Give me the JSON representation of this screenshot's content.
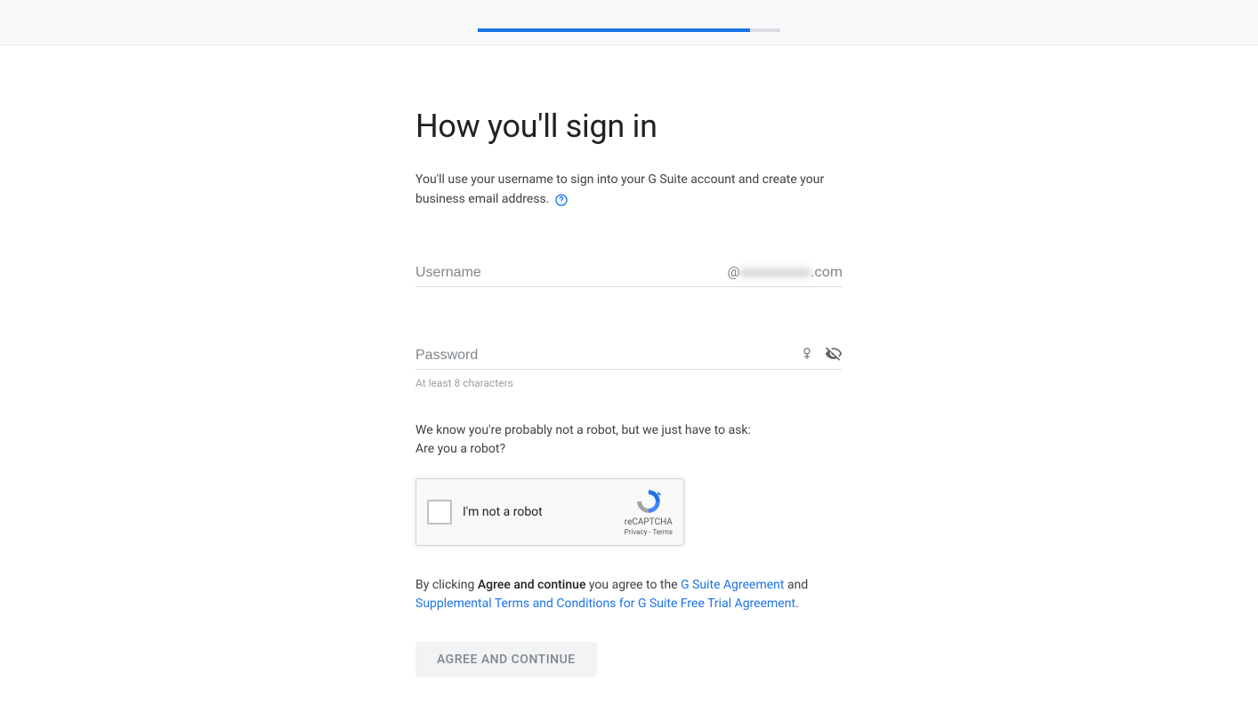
{
  "progress": {
    "percent": 90
  },
  "heading": "How you'll sign in",
  "subtitle": "You'll use your username to sign into your G Suite account and create your business email address.",
  "username": {
    "placeholder": "Username",
    "domain_prefix": "@",
    "domain_obscured": "xxxxxxxxxx",
    "domain_suffix": ".com"
  },
  "password": {
    "placeholder": "Password",
    "helper": "At least 8 characters"
  },
  "robot": {
    "line1": "We know you're probably not a robot, but we just have to ask:",
    "line2": "Are you a robot?"
  },
  "recaptcha": {
    "label": "I'm not a robot",
    "brand": "reCAPTCHA",
    "links": "Privacy - Terms"
  },
  "legal": {
    "prefix": "By clicking ",
    "bold": "Agree and continue",
    "middle": " you agree to the ",
    "link1": "G Suite Agreement",
    "and": " and ",
    "link2": "Supplemental Terms and Conditions for G Suite Free Trial Agreement",
    "period": "."
  },
  "button": "Agree and continue"
}
